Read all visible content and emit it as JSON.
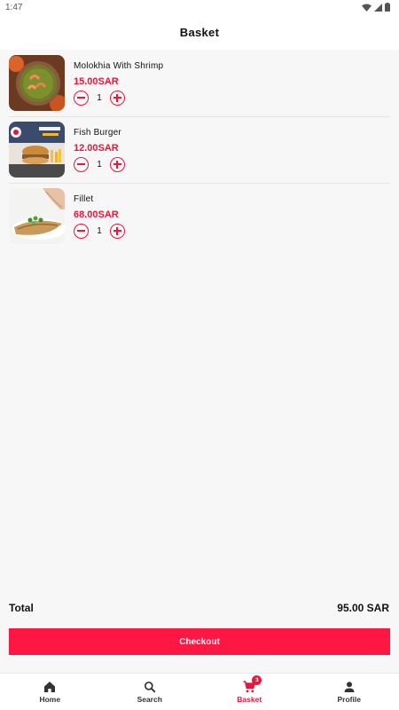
{
  "status_bar": {
    "time": "1:47",
    "icons": [
      "wifi-icon",
      "signal-icon",
      "battery-icon"
    ]
  },
  "header": {
    "title": "Basket"
  },
  "basket": {
    "items": [
      {
        "name": "Molokhia With Shrimp",
        "price": "15.00SAR",
        "quantity": "1",
        "image": "molokhia-shrimp-photo"
      },
      {
        "name": "Fish Burger",
        "price": "12.00SAR",
        "quantity": "1",
        "image": "fish-burger-photo"
      },
      {
        "name": "Fillet",
        "price": "68.00SAR",
        "quantity": "1",
        "image": "fish-fillet-photo"
      }
    ],
    "quantity_controls": {
      "decrease_icon": "minus-circle-icon",
      "increase_icon": "plus-circle-icon"
    }
  },
  "summary": {
    "total_label": "Total",
    "total_value": "95.00 SAR"
  },
  "checkout": {
    "label": "Checkout"
  },
  "nav": {
    "items": [
      {
        "label": "Home",
        "icon": "home-icon"
      },
      {
        "label": "Search",
        "icon": "search-icon"
      },
      {
        "label": "Basket",
        "icon": "cart-icon",
        "badge": "3",
        "active": true
      },
      {
        "label": "Profile",
        "icon": "person-icon"
      }
    ]
  },
  "colors": {
    "accent": "#e8173d",
    "checkout_button": "#ff1744",
    "background": "#f7f7f7"
  }
}
